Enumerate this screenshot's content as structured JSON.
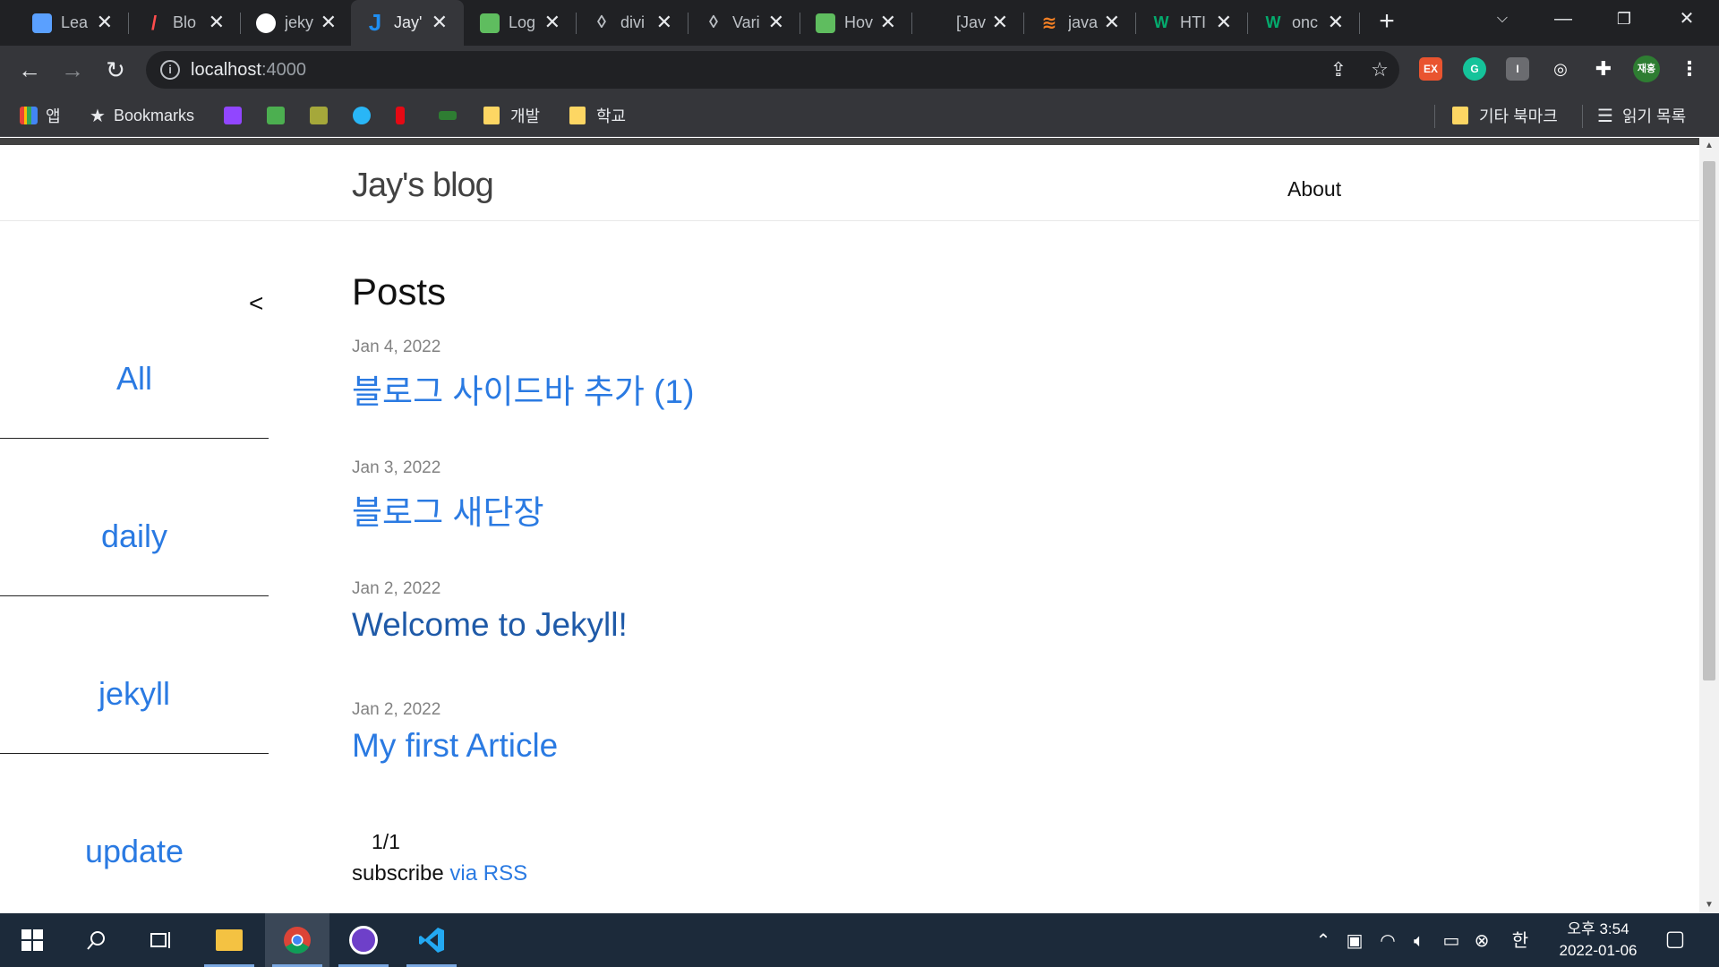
{
  "browser": {
    "tabs": [
      {
        "title": "Lea",
        "favicon_color": "#5aa0ff",
        "favicon_text": "",
        "active": false
      },
      {
        "title": "Blo",
        "favicon_color": "#ff4d4d",
        "favicon_text": "",
        "active": false
      },
      {
        "title": "jeky",
        "favicon_color": "#ffffff",
        "favicon_text": "",
        "active": false
      },
      {
        "title": "Jay'",
        "favicon_color": "#1f8ef1",
        "favicon_text": "J",
        "active": true
      },
      {
        "title": "Log",
        "favicon_color": "#5fbd5f",
        "favicon_text": "",
        "active": false
      },
      {
        "title": "divi",
        "favicon_color": "#bdc1c6",
        "favicon_text": "",
        "active": false
      },
      {
        "title": "Vari",
        "favicon_color": "#bdc1c6",
        "favicon_text": "",
        "active": false
      },
      {
        "title": "Hov",
        "favicon_color": "#5fbd5f",
        "favicon_text": "",
        "active": false
      },
      {
        "title": "[Jav",
        "favicon_color": "#202124",
        "favicon_text": "",
        "active": false
      },
      {
        "title": "java",
        "favicon_color": "#f48024",
        "favicon_text": "",
        "active": false
      },
      {
        "title": "HTI",
        "favicon_color": "#04aa6d",
        "favicon_text": "W",
        "active": false
      },
      {
        "title": "onc",
        "favicon_color": "#04aa6d",
        "favicon_text": "W",
        "active": false
      }
    ],
    "url_host": "localhost",
    "url_port": ":4000",
    "profile_label": "재홍",
    "bookmarks": {
      "apps_label": "앱",
      "bookmarks_label": "Bookmarks",
      "folder_dev": "개발",
      "folder_school": "학교",
      "other_bookmarks": "기타 북마크",
      "reading_list": "읽기 목록"
    }
  },
  "site": {
    "title": "Jay's blog",
    "nav_about": "About",
    "sidebar_toggle": "<",
    "categories": [
      "All",
      "daily",
      "jekyll",
      "update"
    ],
    "heading": "Posts",
    "posts": [
      {
        "date": "Jan 4, 2022",
        "title": "블로그 사이드바 추가 (1)"
      },
      {
        "date": "Jan 3, 2022",
        "title": "블로그 새단장"
      },
      {
        "date": "Jan 2, 2022",
        "title": "Welcome to Jekyll!"
      },
      {
        "date": "Jan 2, 2022",
        "title": "My first Article"
      }
    ],
    "pagination": "1/1",
    "subscribe_text": "subscribe ",
    "rss_link": "via RSS"
  },
  "taskbar": {
    "ime": "한",
    "time": "오후 3:54",
    "date": "2022-01-06"
  },
  "colors": {
    "link": "#2a7ae2",
    "chrome_dark": "#202124",
    "toolbar": "#35363a",
    "taskbar": "#1c2a3a"
  }
}
